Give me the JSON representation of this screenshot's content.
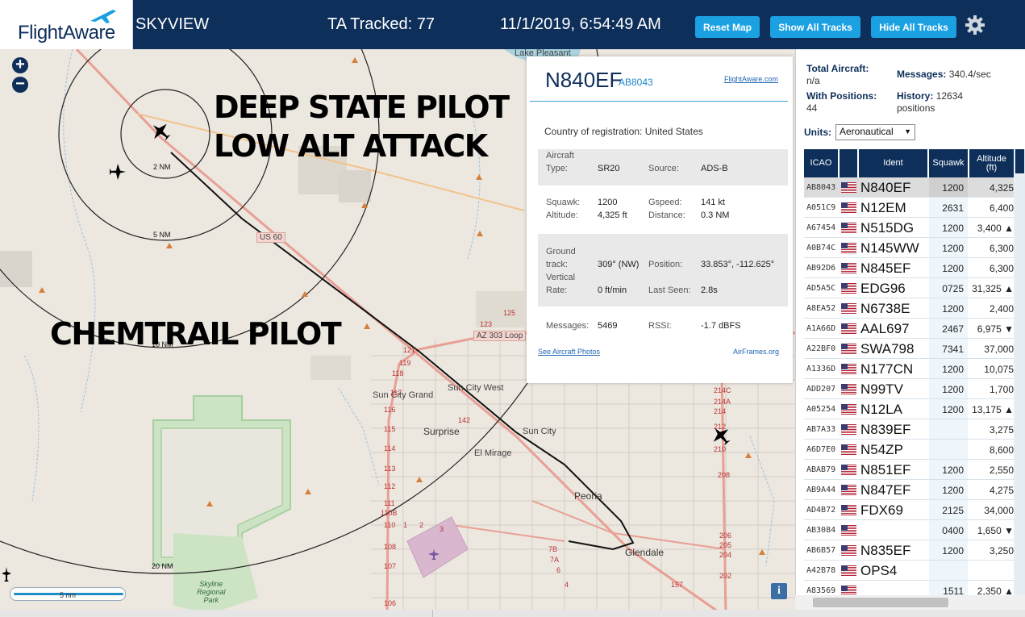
{
  "header": {
    "logo": "FlightAware",
    "title": "SKYVIEW",
    "tracked": "TA Tracked: 77",
    "datetime": "11/1/2019, 6:54:49 AM",
    "buttons": {
      "reset": "Reset Map",
      "show_all": "Show All Tracks",
      "hide_all": "Hide All Tracks"
    },
    "settings_icon": "gear-icon"
  },
  "map": {
    "zoom_in": "+",
    "zoom_out": "−",
    "overlay": {
      "line1": "DEEP STATE PILOT",
      "line2": "LOW ALT ATTACK",
      "line3": "CHEMTRAIL PILOT"
    },
    "rings": [
      "2 NM",
      "5 NM",
      "10 NM",
      "20 NM"
    ],
    "places": {
      "lake_pleasant": "Lake Pleasant",
      "us60": "US 60",
      "az303": "AZ 303 Loop",
      "sun_city_grand": "Sun City Grand",
      "sun_city_west": "Sun City West",
      "surprise": "Surprise",
      "sun_city": "Sun City",
      "el_mirage": "El Mirage",
      "peoria": "Peoria",
      "glendale": "Glendale",
      "skyline": "Skyline\nRegional\nPark"
    },
    "route_numbers": [
      "125",
      "123",
      "121",
      "119",
      "118",
      "117",
      "116",
      "115",
      "114",
      "113",
      "112",
      "111",
      "110B",
      "110",
      "108",
      "107",
      "106",
      "142",
      "214C",
      "214A",
      "214",
      "212",
      "210",
      "208",
      "206",
      "205",
      "204",
      "202",
      "157",
      "1",
      "2",
      "3",
      "7B",
      "7A",
      "6",
      "4"
    ],
    "scale": "5 nm",
    "info": "i"
  },
  "popup": {
    "ident": "N840EF",
    "icao": "AB8043",
    "flightaware_link": "FlightAware.com",
    "country_label": "Country of registration:",
    "country": "United States",
    "aircraft_type_label": "Aircraft\nType:",
    "aircraft_type": "SR20",
    "source_label": "Source:",
    "source": "ADS-B",
    "squawk_label": "Squawk:",
    "squawk": "1200",
    "altitude_label": "Altitude:",
    "altitude": "4,325 ft",
    "gspeed_label": "Gspeed:",
    "gspeed": "141 kt",
    "distance_label": "Distance:",
    "distance": "0.3 NM",
    "ground_track_label": "Ground\ntrack:",
    "ground_track": "309° (NW)",
    "vertical_rate_label": "Vertical\nRate:",
    "vertical_rate": "0 ft/min",
    "position_label": "Position:",
    "position": "33.853°, -112.625°",
    "last_seen_label": "Last Seen:",
    "last_seen": "2.8s",
    "messages_label": "Messages:",
    "messages": "5469",
    "rssi_label": "RSSI:",
    "rssi": "-1.7 dBFS",
    "photos_link": "See Aircraft Photos",
    "airframes_link": "AirFrames.org"
  },
  "sidebar": {
    "total_label": "Total Aircraft:",
    "total_value": "n/a",
    "positions_label": "With Positions:",
    "positions_value": "44",
    "messages_label": "Messages:",
    "messages_value": "340.4/sec",
    "history_label": "History:",
    "history_value": "12634",
    "history_unit": "positions",
    "units_label": "Units:",
    "units_value": "Aeronautical",
    "columns": [
      "ICAO",
      "",
      "Ident",
      "Squawk",
      "Altitude\n(ft)"
    ],
    "rows": [
      {
        "icao": "AB8043",
        "ident": "N840EF",
        "squawk": "1200",
        "alt": "4,325",
        "selected": true
      },
      {
        "icao": "A051C9",
        "ident": "N12EM",
        "squawk": "2631",
        "alt": "6,400"
      },
      {
        "icao": "A67454",
        "ident": "N515DG",
        "squawk": "1200",
        "alt": "3,400 ▲"
      },
      {
        "icao": "A0B74C",
        "ident": "N145WW",
        "squawk": "1200",
        "alt": "6,300"
      },
      {
        "icao": "AB92D6",
        "ident": "N845EF",
        "squawk": "1200",
        "alt": "6,300"
      },
      {
        "icao": "AD5A5C",
        "ident": "EDG96",
        "squawk": "0725",
        "alt": "31,325 ▲"
      },
      {
        "icao": "A8EA52",
        "ident": "N6738E",
        "squawk": "1200",
        "alt": "2,400"
      },
      {
        "icao": "A1A66D",
        "ident": "AAL697",
        "squawk": "2467",
        "alt": "6,975 ▼"
      },
      {
        "icao": "A22BF0",
        "ident": "SWA798",
        "squawk": "7341",
        "alt": "37,000"
      },
      {
        "icao": "A1336D",
        "ident": "N177CN",
        "squawk": "1200",
        "alt": "10,075"
      },
      {
        "icao": "ADD207",
        "ident": "N99TV",
        "squawk": "1200",
        "alt": "1,700"
      },
      {
        "icao": "A05254",
        "ident": "N12LA",
        "squawk": "1200",
        "alt": "13,175 ▲"
      },
      {
        "icao": "AB7A33",
        "ident": "N839EF",
        "squawk": "",
        "alt": "3,275"
      },
      {
        "icao": "A6D7E0",
        "ident": "N54ZP",
        "squawk": "",
        "alt": "8,600"
      },
      {
        "icao": "ABAB79",
        "ident": "N851EF",
        "squawk": "1200",
        "alt": "2,550"
      },
      {
        "icao": "AB9A44",
        "ident": "N847EF",
        "squawk": "1200",
        "alt": "4,275"
      },
      {
        "icao": "AD4B72",
        "ident": "FDX69",
        "squawk": "2125",
        "alt": "34,000"
      },
      {
        "icao": "AB3084",
        "ident": "",
        "squawk": "0400",
        "alt": "1,650 ▼"
      },
      {
        "icao": "AB6B57",
        "ident": "N835EF",
        "squawk": "1200",
        "alt": "3,250"
      },
      {
        "icao": "A42B78",
        "ident": "OPS4",
        "squawk": "",
        "alt": ""
      },
      {
        "icao": "A83569",
        "ident": "",
        "squawk": "1511",
        "alt": "2,350 ▲"
      }
    ]
  },
  "colors": {
    "header_bg": "#0d2f5a",
    "button_bg": "#1ba1e2",
    "accent": "#1e88c9",
    "map_bg": "#ece7df"
  }
}
